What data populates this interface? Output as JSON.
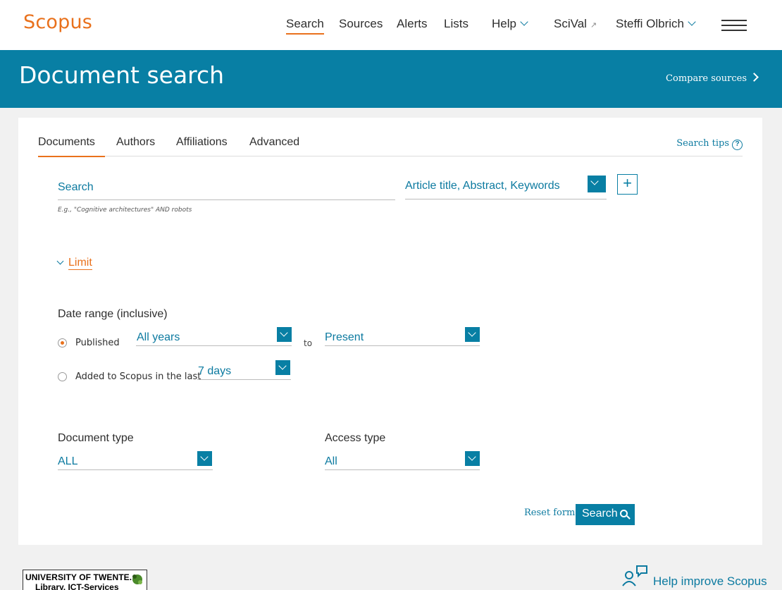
{
  "header": {
    "logo": "Scopus",
    "nav": [
      {
        "label": "Search"
      },
      {
        "label": "Sources"
      },
      {
        "label": "Alerts"
      },
      {
        "label": "Lists"
      },
      {
        "label": "Help"
      },
      {
        "label": "SciVal"
      },
      {
        "label": "Steffi Olbrich"
      }
    ],
    "icons": {
      "menu": "hamburger-icon",
      "external": "external-link-icon",
      "dropdown": "chevron-down-icon"
    }
  },
  "banner": {
    "title": "Document search",
    "compare_label": "Compare sources"
  },
  "tabs": [
    "Documents",
    "Authors",
    "Affiliations",
    "Advanced"
  ],
  "search_tips": "Search tips",
  "search": {
    "placeholder": "Search",
    "field": "Article title, Abstract, Keywords",
    "hint": "E.g., \"Cognitive architectures\" AND robots"
  },
  "limit": {
    "label": "Limit"
  },
  "date_range": {
    "label": "Date range (inclusive)",
    "published_label": "Published",
    "from": "All years",
    "to_label": "to",
    "to": "Present",
    "added_label": "Added to Scopus in the last",
    "added_value": "7 days",
    "selected": "published"
  },
  "document_type": {
    "label": "Document type",
    "value": "ALL"
  },
  "access_type": {
    "label": "Access type",
    "value": "All"
  },
  "actions": {
    "reset": "Reset form",
    "search": "Search"
  },
  "footer": {
    "institution_line1": "UNIVERSITY OF TWENTE.",
    "institution_line2": "Library, ICT-Services",
    "help_improve": "Help improve Scopus"
  },
  "colors": {
    "brand": "#e9711c",
    "accent": "#087fa4",
    "link": "#0c7aa0"
  }
}
